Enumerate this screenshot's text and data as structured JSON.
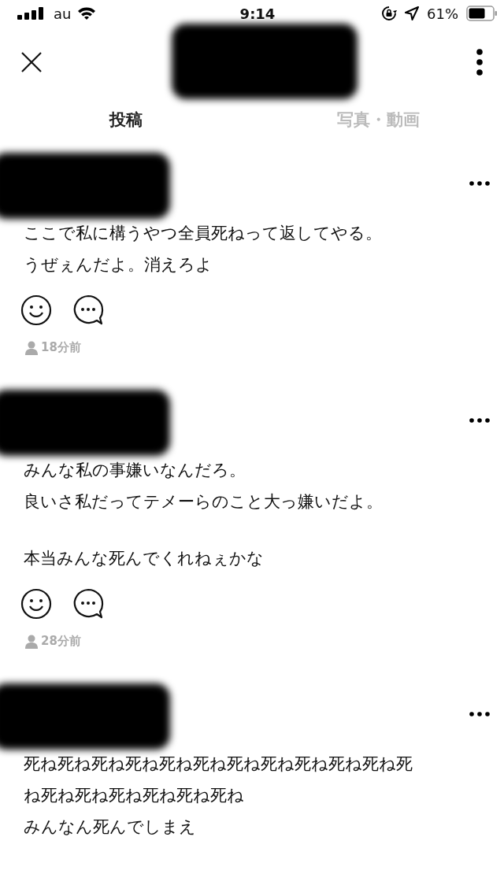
{
  "status_bar": {
    "carrier": "au",
    "time": "9:14",
    "battery": "61%"
  },
  "tabs": [
    {
      "label": "投稿",
      "selected": true
    },
    {
      "label": "写真・動画",
      "selected": false
    }
  ],
  "posts": [
    {
      "paragraphs": [
        [
          "ここで私に構うやつ全員死ねって返してやる。",
          "うぜぇんだよ。消えろよ"
        ]
      ],
      "time": "18分前"
    },
    {
      "paragraphs": [
        [
          "みんな私の事嫌いなんだろ。",
          "良いさ私だってテメーらのこと大っ嫌いだよ。"
        ],
        [
          "本当みんな死んでくれねぇかな"
        ]
      ],
      "time": "28分前"
    },
    {
      "paragraphs": [
        [
          "死ね死ね死ね死ね死ね死ね死ね死ね死ね死ね死ね死",
          "ね死ね死ね死ね死ね死ね死ね",
          "みんなん死んでしまえ"
        ]
      ]
    }
  ]
}
